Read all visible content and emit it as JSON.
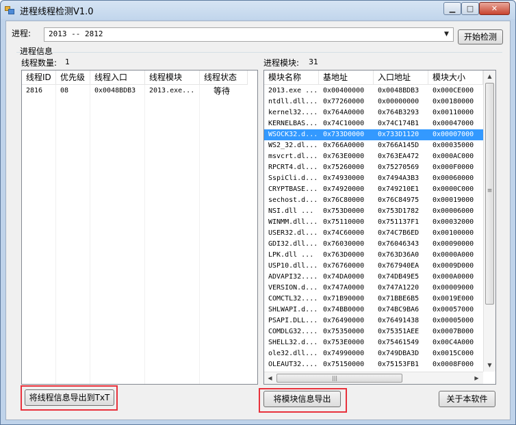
{
  "window": {
    "title": "进程线程检测V1.0",
    "min_glyph": "▁",
    "max_glyph": "□",
    "close_glyph": "✕"
  },
  "process": {
    "label": "进程:",
    "selected": "2013 -- 2812",
    "dropdown_icon": "▼",
    "start_button": "开始检测"
  },
  "info": {
    "group_title": "进程信息",
    "thread_count_label": "线程数量:",
    "thread_count": "1",
    "module_count_label": "进程模块:",
    "module_count": "31"
  },
  "thread_table": {
    "columns": [
      "线程ID",
      "优先级",
      "线程入口",
      "线程模块",
      "线程状态"
    ],
    "rows": [
      [
        "2816",
        "08",
        "0x0048BDB3",
        "2013.exe...",
        "等待"
      ]
    ]
  },
  "module_table": {
    "columns": [
      "模块名称",
      "基地址",
      "入口地址",
      "模块大小"
    ],
    "selected_index": 4,
    "rows": [
      [
        "2013.exe ...",
        "0x00400000",
        "0x0048BDB3",
        "0x000CE000"
      ],
      [
        "ntdll.dll...",
        "0x77260000",
        "0x00000000",
        "0x00180000"
      ],
      [
        "kernel32....",
        "0x764A0000",
        "0x764B3293",
        "0x00110000"
      ],
      [
        "KERNELBAS...",
        "0x74C10000",
        "0x74C174B1",
        "0x00047000"
      ],
      [
        "WSOCK32.d...",
        "0x733D0000",
        "0x733D1120",
        "0x00007000"
      ],
      [
        "WS2_32.dl...",
        "0x766A0000",
        "0x766A145D",
        "0x00035000"
      ],
      [
        "msvcrt.dl...",
        "0x763E0000",
        "0x763EA472",
        "0x000AC000"
      ],
      [
        "RPCRT4.dl...",
        "0x75260000",
        "0x75270569",
        "0x000F0000"
      ],
      [
        "SspiCli.d...",
        "0x74930000",
        "0x7494A3B3",
        "0x00060000"
      ],
      [
        "CRYPTBASE...",
        "0x74920000",
        "0x749210E1",
        "0x0000C000"
      ],
      [
        "sechost.d...",
        "0x76C80000",
        "0x76C84975",
        "0x00019000"
      ],
      [
        "NSI.dll   ...",
        "0x753D0000",
        "0x753D1782",
        "0x00006000"
      ],
      [
        "WINMM.dll...",
        "0x75110000",
        "0x751137F1",
        "0x00032000"
      ],
      [
        "USER32.dl...",
        "0x74C60000",
        "0x74C7B6ED",
        "0x00100000"
      ],
      [
        "GDI32.dll...",
        "0x76030000",
        "0x76046343",
        "0x00090000"
      ],
      [
        "LPK.dll   ...",
        "0x763D0000",
        "0x763D36A0",
        "0x0000A000"
      ],
      [
        "USP10.dll...",
        "0x76760000",
        "0x767940EA",
        "0x0009D000"
      ],
      [
        "ADVAPI32....",
        "0x74DA0000",
        "0x74DB49E5",
        "0x000A0000"
      ],
      [
        "VERSION.d...",
        "0x747A0000",
        "0x747A1220",
        "0x00009000"
      ],
      [
        "COMCTL32....",
        "0x71B90000",
        "0x71BBE6B5",
        "0x0019E000"
      ],
      [
        "SHLWAPI.d...",
        "0x74BB0000",
        "0x74BC9BA6",
        "0x00057000"
      ],
      [
        "PSAPI.DLL...",
        "0x76490000",
        "0x76491438",
        "0x00005000"
      ],
      [
        "COMDLG32....",
        "0x75350000",
        "0x75351AEE",
        "0x0007B000"
      ],
      [
        "SHELL32.d...",
        "0x753E0000",
        "0x75461549",
        "0x00C4A000"
      ],
      [
        "ole32.dll...",
        "0x74990000",
        "0x749DBA3D",
        "0x0015C000"
      ],
      [
        "OLEAUT32....",
        "0x75150000",
        "0x75153FB1",
        "0x0008F000"
      ]
    ]
  },
  "scroll": {
    "up": "▲",
    "down": "▼",
    "left": "◀",
    "right": "▶",
    "grip": "≡",
    "hgrip": "|||"
  },
  "buttons": {
    "export_threads": "将线程信息导出到TxT",
    "export_modules": "将模块信息导出",
    "about": "关于本软件"
  },
  "colors": {
    "selection": "#3399ff",
    "highlight_box": "#e8303a"
  }
}
